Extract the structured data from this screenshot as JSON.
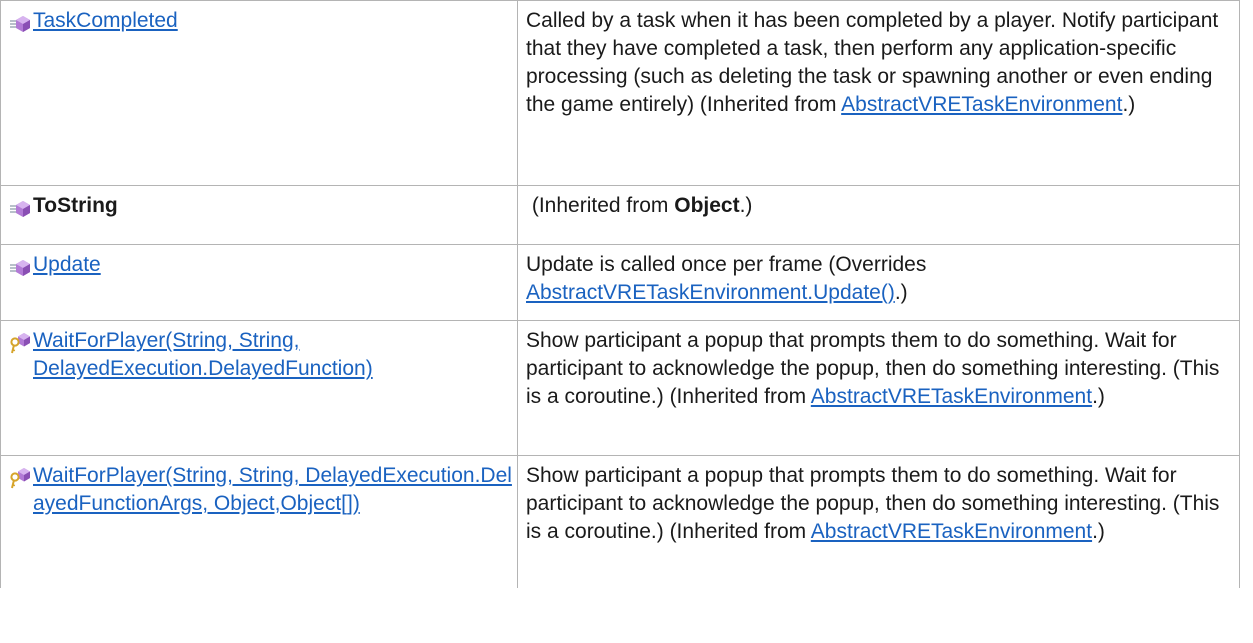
{
  "rows": [
    {
      "icon": "public-method-icon",
      "name": "TaskCompleted",
      "name_is_link": true,
      "desc_before": "Called by a task when it has been completed by a player. Notify participant that they have completed a task, then perform any application-specific processing (such as deleting the task or spawning another or even ending the game entirely) (Inherited from ",
      "desc_link": "AbstractVRETaskEnvironment",
      "desc_after": ".)"
    },
    {
      "icon": "public-method-icon",
      "name": "ToString",
      "name_is_link": false,
      "desc_before": " (Inherited from ",
      "desc_bold": "Object",
      "desc_after": ".)"
    },
    {
      "icon": "public-method-icon",
      "name": "Update",
      "name_is_link": true,
      "desc_before": "Update is called once per frame (Overrides ",
      "desc_link": "AbstractVRETaskEnvironment.Update()",
      "desc_after": ".)"
    },
    {
      "icon": "protected-method-icon",
      "name": "WaitForPlayer(String, String, DelayedExecution.DelayedFunction)",
      "name_is_link": true,
      "desc_before": "Show participant a popup that prompts them to do something. Wait for participant to acknowledge the popup, then do something interesting. (This is a coroutine.) (Inherited from ",
      "desc_link": "AbstractVRETaskEnvironment",
      "desc_after": ".)"
    },
    {
      "icon": "protected-method-icon",
      "name": "WaitForPlayer(String, String, DelayedExecution.DelayedFunctionArgs, Object,Object[])",
      "name_is_link": true,
      "desc_before": "Show participant a popup that prompts them to do something. Wait for participant to acknowledge the popup, then do something interesting. (This is a coroutine.) (Inherited from ",
      "desc_link": "AbstractVRETaskEnvironment",
      "desc_after": ".)"
    }
  ],
  "colors": {
    "link": "#1a62c0",
    "border": "#b4b4b4",
    "method_icon": "#a463c8",
    "protected_key": "#e0b030"
  }
}
